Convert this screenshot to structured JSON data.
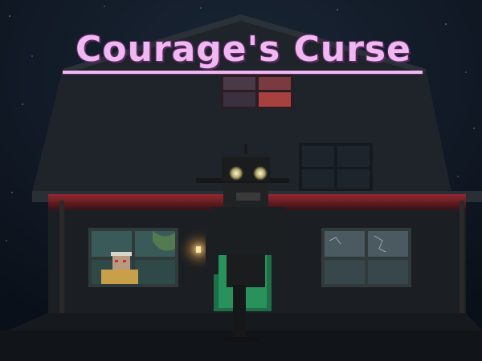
{
  "title": "Courage's Curse",
  "colors": {
    "title": "#f0b8f2",
    "sky": "#101a28",
    "porch_light": "#c8333a",
    "door_glow": "#2fa86a",
    "eyes": "#fff6c8"
  },
  "icons": {
    "title_underline": "underline",
    "farmhouse": "house",
    "shadow_figure": "figure",
    "eustace_window": "old-man-in-window"
  }
}
